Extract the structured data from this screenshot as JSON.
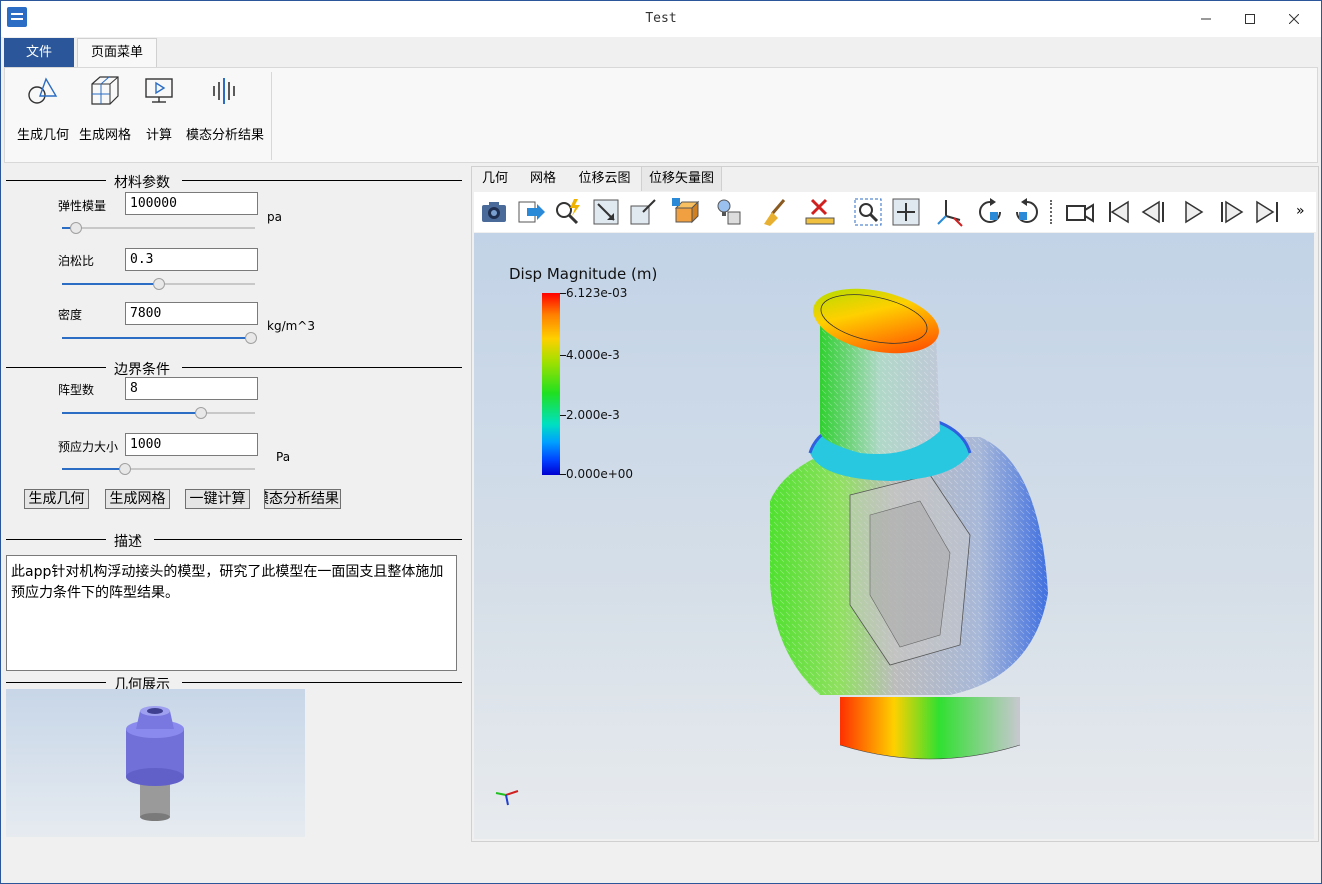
{
  "window": {
    "title": "Test",
    "minimize_icon": "minimize-icon",
    "maximize_icon": "maximize-icon",
    "close_icon": "close-icon"
  },
  "ribbon": {
    "tabs": [
      {
        "label": "文件"
      },
      {
        "label": "页面菜单"
      }
    ],
    "buttons": [
      {
        "label": "生成几何",
        "icon": "geometry-icon"
      },
      {
        "label": "生成网格",
        "icon": "mesh-icon"
      },
      {
        "label": "计算",
        "icon": "compute-icon"
      },
      {
        "label": "模态分析结果",
        "icon": "modal-result-icon"
      }
    ]
  },
  "material": {
    "title": "材料参数",
    "params": [
      {
        "label": "弹性模量",
        "value": "100000",
        "unit": "pa",
        "slider": 0.08
      },
      {
        "label": "泊松比",
        "value": "0.3",
        "unit": "",
        "slider": 0.5
      },
      {
        "label": "密度",
        "value": "7800",
        "unit": "kg/m^3",
        "slider": 1.0
      }
    ]
  },
  "boundary": {
    "title": "边界条件",
    "params": [
      {
        "label": "阵型数",
        "value": "8",
        "unit": "",
        "slider": 0.72
      },
      {
        "label": "预应力大小",
        "value": "1000",
        "unit": "Pa",
        "slider": 0.33
      }
    ]
  },
  "actions": [
    "生成几何",
    "生成网格",
    "一键计算",
    "模态分析结果"
  ],
  "description": {
    "title": "描述",
    "text": "此app针对机构浮动接头的模型，研究了此模型在一面固支且整体施加预应力条件下的阵型结果。"
  },
  "geometry_preview": {
    "title": "几何展示"
  },
  "viewer": {
    "tabs": [
      "几何",
      "网格",
      "位移云图",
      "位移矢量图"
    ],
    "toolbar": [
      "screenshot-icon",
      "export-icon",
      "probe-icon",
      "fit-view-icon",
      "zoom-box-icon",
      "cube-color-icon",
      "light-icon",
      "clear-icon",
      "ruler-icon",
      "zoom-region-icon",
      "pan-icon",
      "axes-icon",
      "rotate-cw-icon",
      "rotate-ccw-icon",
      "camera-icon",
      "first-frame-icon",
      "prev-frame-icon",
      "play-icon",
      "next-frame-icon",
      "last-frame-icon",
      "more-icon"
    ],
    "more_glyph": "»",
    "legend": {
      "title": "Disp Magnitude (m)",
      "labels": [
        "6.123e-03",
        "4.000e-3",
        "2.000e-3",
        "0.000e+00"
      ]
    }
  },
  "colors": {
    "accent": "#2b579a",
    "file_tab": "#2b579a"
  }
}
